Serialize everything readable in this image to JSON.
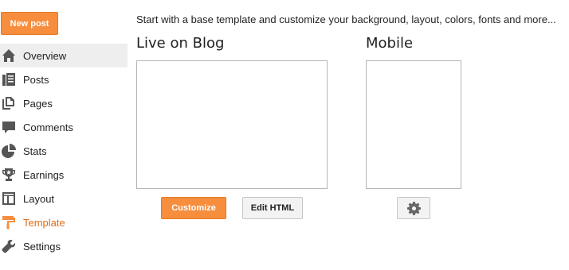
{
  "new_post_label": "New post",
  "sidebar": {
    "items": [
      {
        "label": "Overview",
        "icon": "home-icon"
      },
      {
        "label": "Posts",
        "icon": "posts-icon"
      },
      {
        "label": "Pages",
        "icon": "pages-icon"
      },
      {
        "label": "Comments",
        "icon": "comment-icon"
      },
      {
        "label": "Stats",
        "icon": "pie-chart-icon"
      },
      {
        "label": "Earnings",
        "icon": "trophy-icon"
      },
      {
        "label": "Layout",
        "icon": "layout-icon"
      },
      {
        "label": "Template",
        "icon": "paint-roller-icon"
      },
      {
        "label": "Settings",
        "icon": "wrench-icon"
      }
    ]
  },
  "main": {
    "intro": "Start with a base template and customize your background, layout, colors, fonts and more...",
    "live_title": "Live on Blog",
    "mobile_title": "Mobile",
    "customize_label": "Customize",
    "edit_html_label": "Edit HTML",
    "mobile_settings_icon": "gear-icon"
  },
  "colors": {
    "accent": "#f68e3e",
    "active_nav_text": "#dd6b1a",
    "icon": "#555555",
    "template_icon": "#f68e3e"
  }
}
